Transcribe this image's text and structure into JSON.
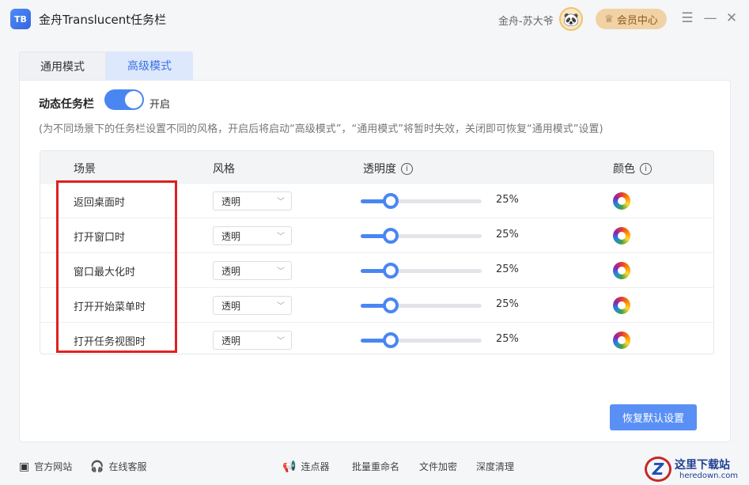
{
  "app": {
    "logo_text": "TB",
    "title": "金舟Translucent任务栏",
    "user_name": "金舟-苏大爷",
    "avatar_icon": "panda-avatar",
    "vip_label": "会员中心",
    "menu_icon": "☰",
    "minimize_icon": "—",
    "close_icon": "✕"
  },
  "tabs": [
    {
      "label": "通用模式",
      "active": false
    },
    {
      "label": "高级模式",
      "active": true
    }
  ],
  "dynamic": {
    "label": "动态任务栏",
    "toggle_state": "on",
    "toggle_text": "开启",
    "hint": "(为不同场景下的任务栏设置不同的风格，开启后将启动“高级模式”，“通用模式”将暂时失效，关闭即可恢复“通用模式”设置)"
  },
  "table": {
    "headers": {
      "scene": "场景",
      "style": "风格",
      "opacity": "透明度",
      "color": "颜色"
    },
    "rows": [
      {
        "scene": "返回桌面时",
        "style": "透明",
        "opacity_percent": 25,
        "opacity_text": "25%"
      },
      {
        "scene": "打开窗口时",
        "style": "透明",
        "opacity_percent": 25,
        "opacity_text": "25%"
      },
      {
        "scene": "窗口最大化时",
        "style": "透明",
        "opacity_percent": 25,
        "opacity_text": "25%"
      },
      {
        "scene": "打开开始菜单时",
        "style": "透明",
        "opacity_percent": 25,
        "opacity_text": "25%"
      },
      {
        "scene": "打开任务视图时",
        "style": "透明",
        "opacity_percent": 25,
        "opacity_text": "25%"
      }
    ]
  },
  "reset_label": "恢复默认设置",
  "footer": {
    "official_site": "官方网站",
    "online_service": "在线客服",
    "clicker": "连点器",
    "batch_rename": "批量重命名",
    "file_encrypt": "文件加密",
    "deep_clean": "深度清理"
  },
  "watermark": {
    "text": "这里下载站",
    "sub": "heredown.com",
    "logo": "Z"
  },
  "colors": {
    "accent": "#4a86f2",
    "highlight": "#e02020",
    "vip": "#f1d2a5"
  }
}
